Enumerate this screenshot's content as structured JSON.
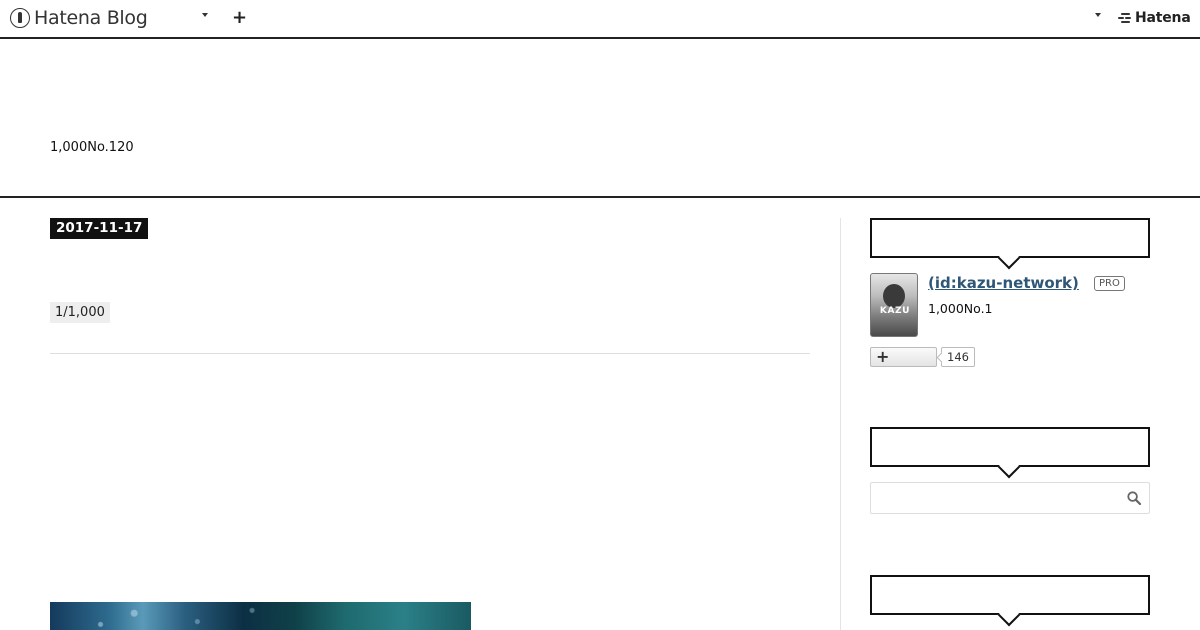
{
  "navbar": {
    "brand": "Hatena Blog",
    "corp_name": "Hatena"
  },
  "blog": {
    "description": "1,000No.120"
  },
  "entry": {
    "date": "2017-11-17",
    "category": "1/1,000"
  },
  "sidebar": {
    "profile": {
      "name": " (id:kazu-network)",
      "badge": "PRO",
      "avatar_text": "KAZU",
      "description": "1,000No.1",
      "subscriber_count": "146"
    },
    "search": {
      "placeholder": "",
      "value": ""
    }
  },
  "icons": [
    "hatena-blog-logo-icon",
    "chevron-down-icon",
    "plus-icon",
    "hatena-logo-icon",
    "search-icon"
  ]
}
